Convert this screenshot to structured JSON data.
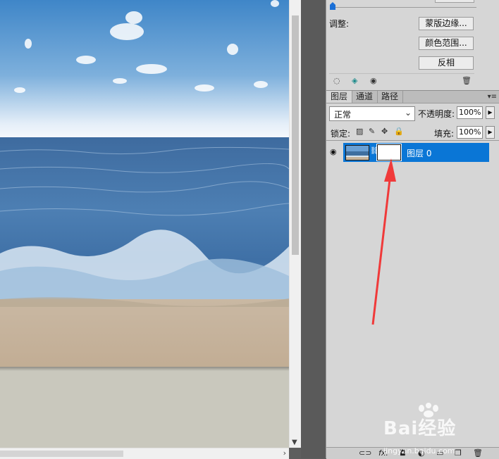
{
  "panel": {
    "adjust_label": "调整:",
    "refine_edge_button": "蒙版边缘...",
    "color_range_button": "颜色范围...",
    "invert_button": "反相",
    "tabs": [
      {
        "label": "图层"
      },
      {
        "label": "通道"
      },
      {
        "label": "路径"
      }
    ],
    "blend_mode": "正常",
    "opacity_label": "不透明度:",
    "opacity_value": "100%",
    "lock_label": "锁定:",
    "fill_label": "填充:",
    "fill_value": "100%",
    "layer": {
      "name": "图层 0"
    }
  },
  "icons": {
    "dotted_circle": "dotted-circle-icon",
    "mask_select": "mask-select-icon",
    "eye": "eye-icon",
    "trash": "trash-icon",
    "chain": "chain-link-icon",
    "link": "link-layers-icon",
    "fx": "fx-icon",
    "add_mask": "add-mask-icon",
    "adjustment": "adjustment-layer-icon",
    "group": "group-folder-icon",
    "new_layer": "new-layer-icon"
  },
  "footer_labels": {
    "fx": "fx."
  },
  "watermark": {
    "text": "Bai经验",
    "url": "jingyan.baidu.com"
  },
  "colors": {
    "selection": "#0a76d6",
    "arrow": "#f03a3a",
    "slider_knob": "#1a6fd6"
  }
}
